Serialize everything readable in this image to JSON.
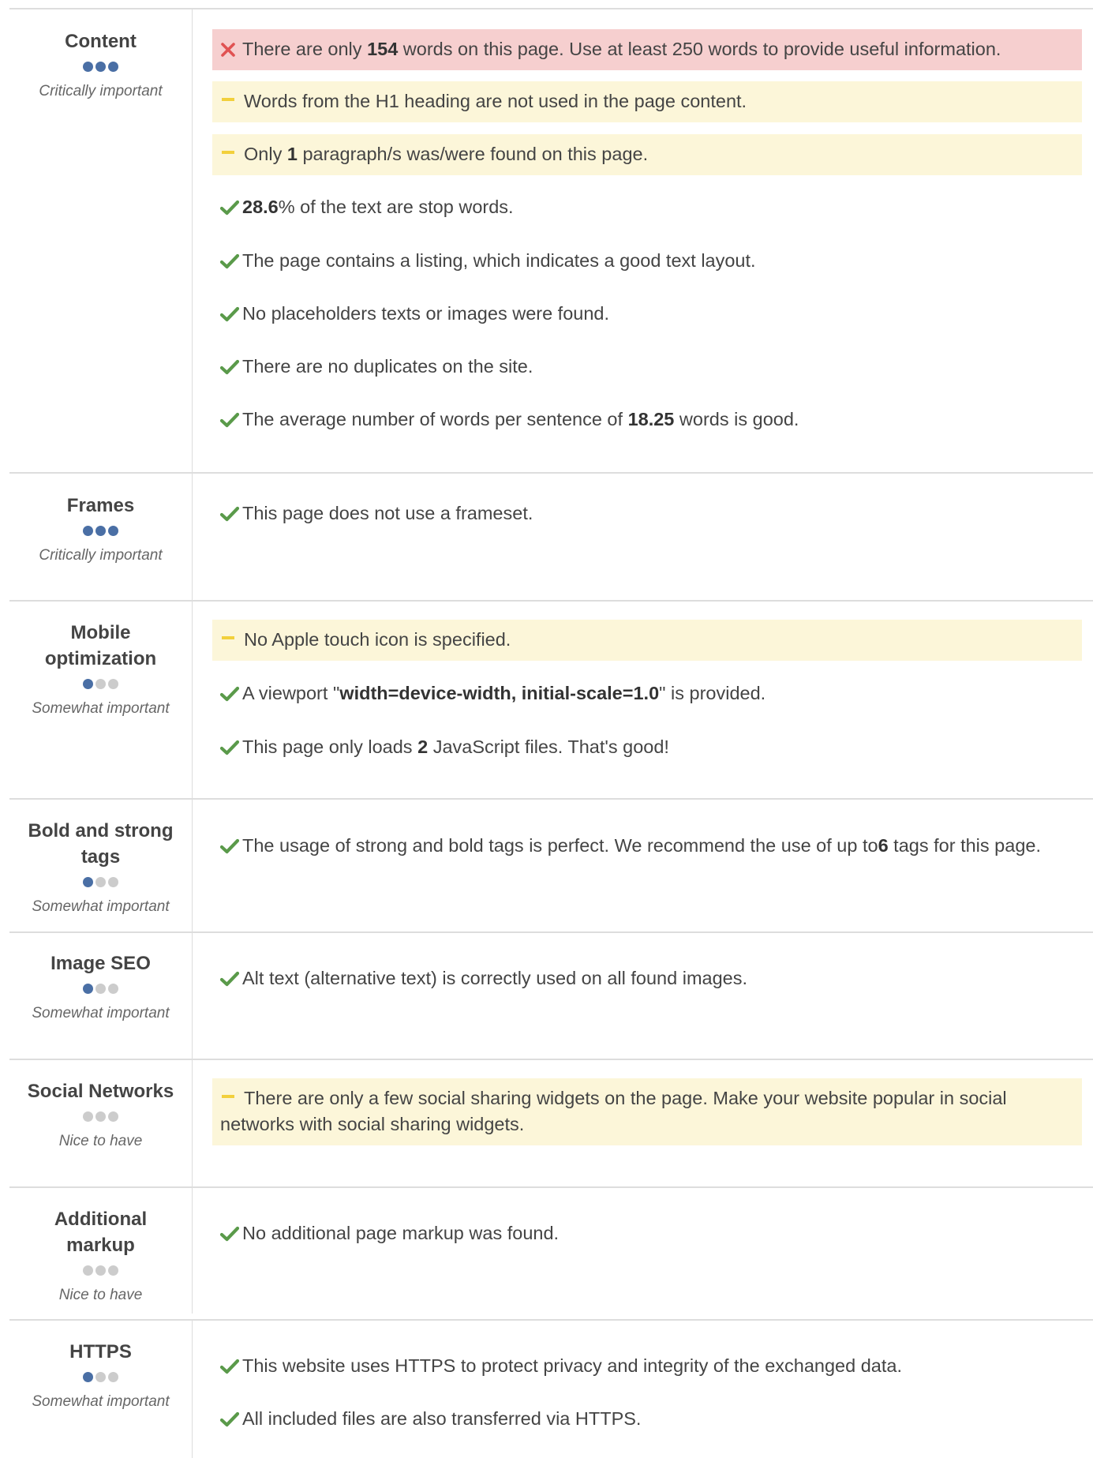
{
  "sections": [
    {
      "title_lines": [
        "Content"
      ],
      "importance": "Critically important",
      "dots": [
        "on",
        "on",
        "on"
      ],
      "messages": [
        {
          "type": "error",
          "parts": [
            "There are only ",
            "154",
            " words on this page. Use at least 250 words to provide useful information."
          ]
        },
        {
          "type": "warning",
          "parts": [
            "Words from the H1 heading are not used in the page content."
          ]
        },
        {
          "type": "warning",
          "parts": [
            "Only ",
            "1",
            " paragraph/s was/were found on this page."
          ]
        },
        {
          "type": "ok",
          "parts": [
            "",
            "28.6",
            "% of the text are stop words."
          ]
        },
        {
          "type": "ok",
          "parts": [
            "The page contains a listing, which indicates a good text layout."
          ]
        },
        {
          "type": "ok",
          "parts": [
            "No placeholders texts or images were found."
          ]
        },
        {
          "type": "ok",
          "parts": [
            "There are no duplicates on the site."
          ]
        },
        {
          "type": "ok",
          "parts": [
            "The average number of words per sentence of ",
            "18.25",
            " words is good."
          ]
        }
      ]
    },
    {
      "title_lines": [
        "Frames"
      ],
      "importance": "Critically important",
      "dots": [
        "on",
        "on",
        "on"
      ],
      "messages": [
        {
          "type": "ok",
          "parts": [
            "This page does not use a frameset."
          ]
        }
      ]
    },
    {
      "title_lines": [
        "Mobile",
        "optimization"
      ],
      "importance": "Somewhat important",
      "dots": [
        "on",
        "off",
        "off"
      ],
      "messages": [
        {
          "type": "warning",
          "parts": [
            "No Apple touch icon is specified."
          ]
        },
        {
          "type": "ok",
          "parts": [
            "A viewport \"",
            "width=device-width, initial-scale=1.0",
            "\" is provided."
          ]
        },
        {
          "type": "ok",
          "parts": [
            "This page only loads ",
            "2",
            " JavaScript files. That's good!"
          ]
        }
      ]
    },
    {
      "title_lines": [
        "Bold and strong",
        "tags"
      ],
      "importance": "Somewhat important",
      "dots": [
        "on",
        "off",
        "off"
      ],
      "messages": [
        {
          "type": "ok",
          "parts": [
            "The usage of strong and bold tags is perfect. We recommend the use of up to",
            "6",
            " tags for this page."
          ]
        }
      ]
    },
    {
      "title_lines": [
        "Image SEO"
      ],
      "importance": "Somewhat important",
      "dots": [
        "on",
        "off",
        "off"
      ],
      "messages": [
        {
          "type": "ok",
          "parts": [
            "Alt text (alternative text) is correctly used on all found images."
          ]
        }
      ]
    },
    {
      "title_lines": [
        "Social Networks"
      ],
      "importance": "Nice to have",
      "dots": [
        "off",
        "off",
        "off"
      ],
      "messages": [
        {
          "type": "warning",
          "parts": [
            "There are only a few social sharing widgets on the page. Make your website popular in social networks with social sharing widgets."
          ]
        }
      ]
    },
    {
      "title_lines": [
        "Additional",
        "markup"
      ],
      "importance": "Nice to have",
      "dots": [
        "off",
        "off",
        "off"
      ],
      "messages": [
        {
          "type": "ok",
          "parts": [
            "No additional page markup was found."
          ]
        }
      ]
    },
    {
      "title_lines": [
        "HTTPS"
      ],
      "importance": "Somewhat important",
      "dots": [
        "on",
        "off",
        "off"
      ],
      "messages": [
        {
          "type": "ok",
          "parts": [
            "This website uses HTTPS to protect privacy and integrity of the exchanged data."
          ]
        },
        {
          "type": "ok",
          "parts": [
            "All included files are also transferred via HTTPS."
          ]
        }
      ]
    }
  ],
  "colors": {
    "error_bg": "#f6cfcf",
    "warning_bg": "#fcf6d9",
    "error_icon": "#e05252",
    "warning_icon": "#f2d03c",
    "ok_icon": "#5a9a4a",
    "dot_active": "#4a6fa5",
    "dot_inactive": "#cccccc"
  },
  "icons": {
    "error": "cross-icon",
    "warning": "dash-icon",
    "ok": "checkmark-icon"
  }
}
